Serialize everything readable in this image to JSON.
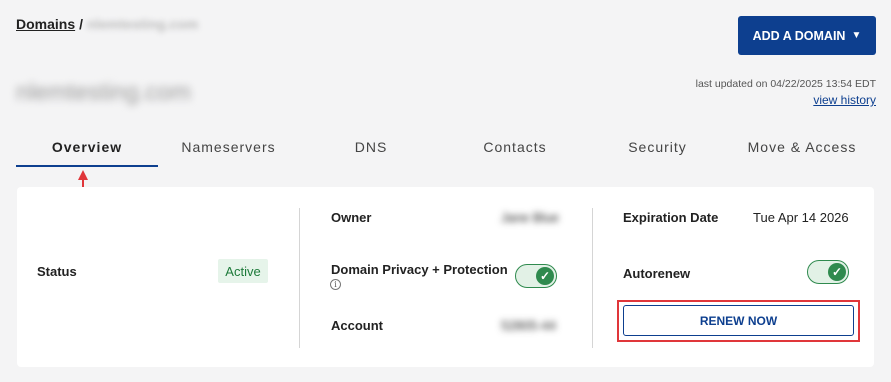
{
  "breadcrumb": {
    "root": "Domains",
    "separator": "/",
    "current": "nlemtesting.com"
  },
  "header": {
    "add_domain_label": "ADD A DOMAIN",
    "domain_name": "nlemtesting.com",
    "last_updated": "last updated on 04/22/2025 13:54 EDT",
    "view_history": "view history"
  },
  "tabs": [
    {
      "label": "Overview",
      "active": true
    },
    {
      "label": "Nameservers"
    },
    {
      "label": "DNS"
    },
    {
      "label": "Contacts"
    },
    {
      "label": "Security"
    },
    {
      "label": "Move & Access"
    }
  ],
  "overview": {
    "status_label": "Status",
    "status_value": "Active",
    "owner_label": "Owner",
    "owner_value": "Jane Blue",
    "privacy_label": "Domain Privacy + Protection",
    "privacy_enabled": true,
    "account_label": "Account",
    "account_value": "52805-44",
    "expiration_label": "Expiration Date",
    "expiration_value": "Tue Apr 14 2026",
    "autorenew_label": "Autorenew",
    "autorenew_enabled": true,
    "renew_label": "RENEW NOW"
  },
  "colors": {
    "primary": "#0d3f8f",
    "success": "#2f8a4e",
    "highlight": "#e0363a"
  },
  "icons": [
    "caret-down-icon",
    "info-icon",
    "check-icon",
    "up-arrow-icon"
  ]
}
